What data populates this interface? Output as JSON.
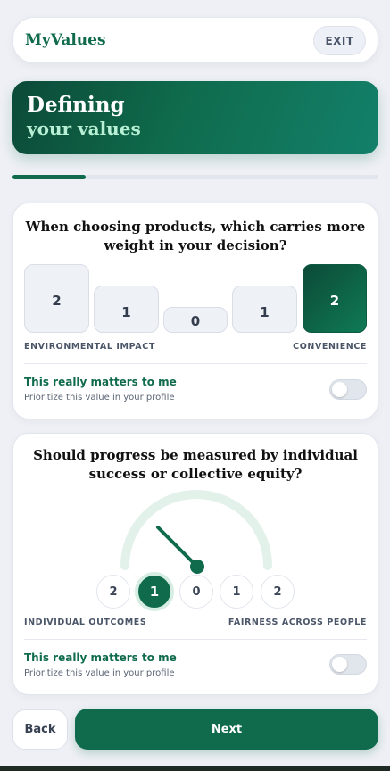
{
  "header": {
    "brand": "MyValues",
    "exit_label": "EXIT"
  },
  "hero": {
    "line1": "Defining",
    "line2": "your values"
  },
  "progress": {
    "fraction": 0.2
  },
  "question1": {
    "text": "When choosing products, which carries more weight in your decision?",
    "options": [
      "2",
      "1",
      "0",
      "1",
      "2"
    ],
    "selected_index": 4,
    "left_label": "ENVIRONMENTAL IMPACT",
    "right_label": "CONVENIENCE",
    "matters_title": "This really matters to me",
    "matters_sub": "Prioritize this value in your profile",
    "matters_on": false
  },
  "question2": {
    "text": "Should progress be measured by individual success or collective equity?",
    "options": [
      "2",
      "1",
      "0",
      "1",
      "2"
    ],
    "selected_index": 1,
    "left_label": "INDIVIDUAL OUTCOMES",
    "right_label": "FAIRNESS ACROSS PEOPLE",
    "matters_title": "This really matters to me",
    "matters_sub": "Prioritize this value in your profile",
    "matters_on": false
  },
  "footer": {
    "back_label": "Back",
    "next_label": "Next"
  },
  "colors": {
    "primary": "#0f6b4c",
    "accent_light": "#b8f0d5",
    "background": "#eef0f5"
  }
}
